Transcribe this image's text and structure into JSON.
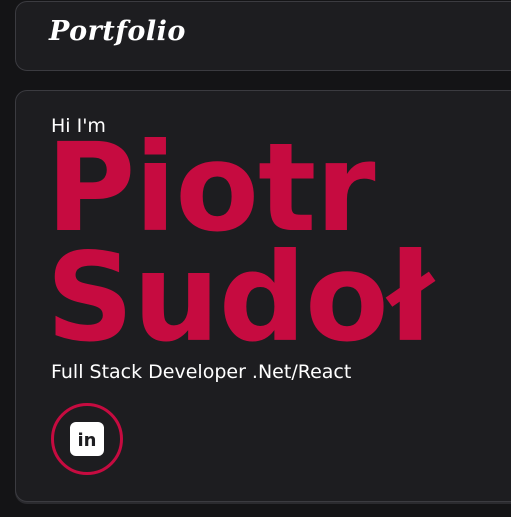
{
  "navbar": {
    "brand": "Portfolio"
  },
  "hero": {
    "greeting": "Hi I'm",
    "first_name": "Piotr",
    "last_name": "Sudoł",
    "role": "Full Stack Developer .Net/React"
  },
  "social": {
    "linkedin": {
      "icon": "linkedin-icon",
      "glyph": "in"
    }
  },
  "colors": {
    "accent": "#c60b40",
    "background": "#141416",
    "card": "#1d1d20",
    "text": "#ffffff"
  }
}
